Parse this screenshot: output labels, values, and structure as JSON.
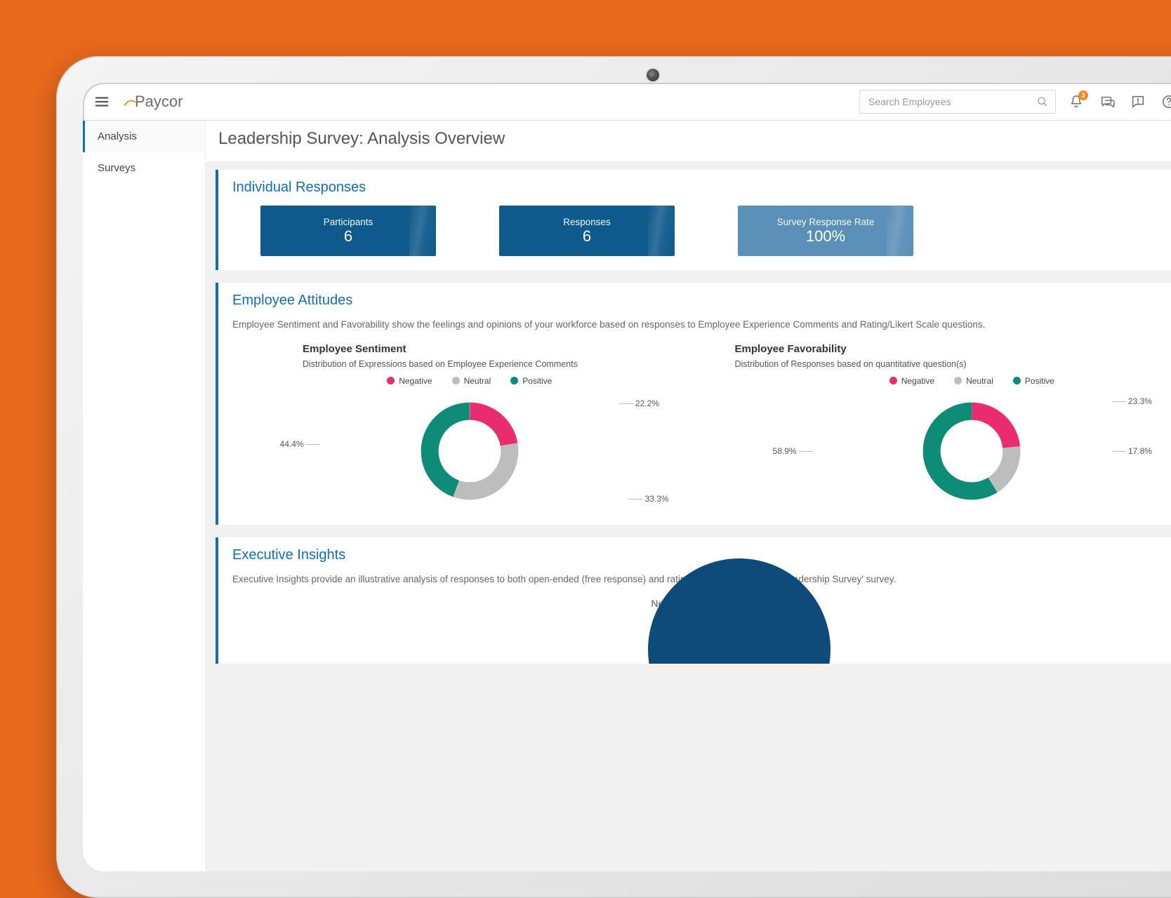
{
  "brand": {
    "name": "Paycor"
  },
  "search": {
    "placeholder": "Search Employees"
  },
  "notifications": {
    "badge_count": 3
  },
  "sidebar": {
    "items": [
      {
        "label": "Analysis",
        "active": true
      },
      {
        "label": "Surveys",
        "active": false
      }
    ]
  },
  "page": {
    "title": "Leadership Survey: Analysis Overview"
  },
  "individual_responses": {
    "heading": "Individual Responses",
    "kpis": [
      {
        "label": "Participants",
        "value": "6",
        "style": "dark"
      },
      {
        "label": "Responses",
        "value": "6",
        "style": "dark"
      },
      {
        "label": "Survey Response Rate",
        "value": "100%",
        "style": "light"
      }
    ]
  },
  "employee_attitudes": {
    "heading": "Employee Attitudes",
    "description": "Employee Sentiment and Favorability show the feelings and opinions of your workforce based on responses to Employee Experience Comments and Rating/Likert Scale questions.",
    "legend": {
      "negative": "Negative",
      "neutral": "Neutral",
      "positive": "Positive"
    },
    "sentiment": {
      "title": "Employee Sentiment",
      "subtitle": "Distribution of Expressions based on Employee Experience Comments",
      "labels": {
        "positive": "44.4%",
        "neutral": "33.3%",
        "negative": "22.2%"
      }
    },
    "favorability": {
      "title": "Employee Favorability",
      "subtitle": "Distribution of Responses based on quantitative question(s)",
      "labels": {
        "positive": "58.9%",
        "neutral": "17.8%",
        "negative": "23.3%"
      }
    }
  },
  "executive_insights": {
    "heading": "Executive Insights",
    "description": "Executive Insights provide an illustrative analysis of responses to both open-ended (free response) and rating question provided in 'Leadership Survey' survey.",
    "negative_label": "Negative Sentiments"
  },
  "colors": {
    "negative": "#e82c6d",
    "neutral": "#bdbdbd",
    "positive": "#0f8c78"
  },
  "chart_data": [
    {
      "type": "pie",
      "title": "Employee Sentiment",
      "subtitle": "Distribution of Expressions based on Employee Experience Comments",
      "series": [
        {
          "name": "Negative",
          "value": 22.2,
          "color": "#e82c6d"
        },
        {
          "name": "Neutral",
          "value": 33.3,
          "color": "#bdbdbd"
        },
        {
          "name": "Positive",
          "value": 44.4,
          "color": "#0f8c78"
        }
      ]
    },
    {
      "type": "pie",
      "title": "Employee Favorability",
      "subtitle": "Distribution of Responses based on quantitative question(s)",
      "series": [
        {
          "name": "Negative",
          "value": 23.3,
          "color": "#e82c6d"
        },
        {
          "name": "Neutral",
          "value": 17.8,
          "color": "#bdbdbd"
        },
        {
          "name": "Positive",
          "value": 58.9,
          "color": "#0f8c78"
        }
      ]
    }
  ]
}
